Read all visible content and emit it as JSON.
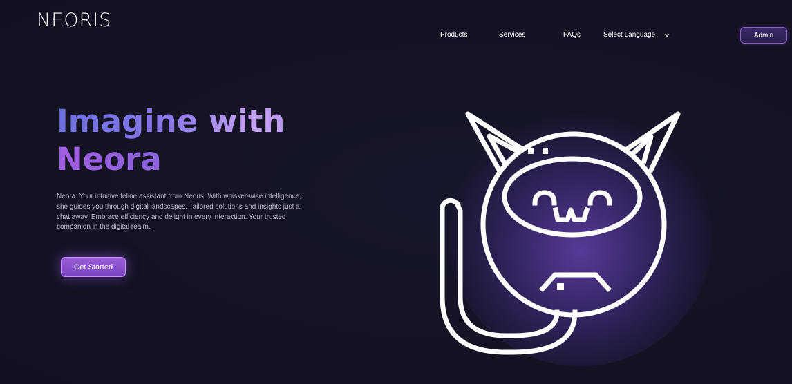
{
  "header": {
    "logo_text": "NEORIS",
    "nav": {
      "products": "Products",
      "services": "Services",
      "faqs": "FAQs",
      "language": "Select Language"
    },
    "admin_label": "Admin"
  },
  "hero": {
    "title_line1": "Imagine with",
    "title_line2": "Neora",
    "description": "Neora: Your intuitive feline assistant from Neoris. With whisker-wise intelligence, she guides you through digital landscapes. Tailored solutions and insights just a chat away. Embrace efficiency and delight in every interaction. Your trusted companion in the digital realm.",
    "cta_label": "Get Started"
  },
  "icons": {
    "language_dropdown": "chevron-down-icon",
    "mascot": "cat-mascot-icon"
  },
  "colors": {
    "background": "#141426",
    "accent": "#9a5ed6",
    "title_gradient_start": "#6b6ee0",
    "title_gradient_end": "#c6a3f3"
  }
}
